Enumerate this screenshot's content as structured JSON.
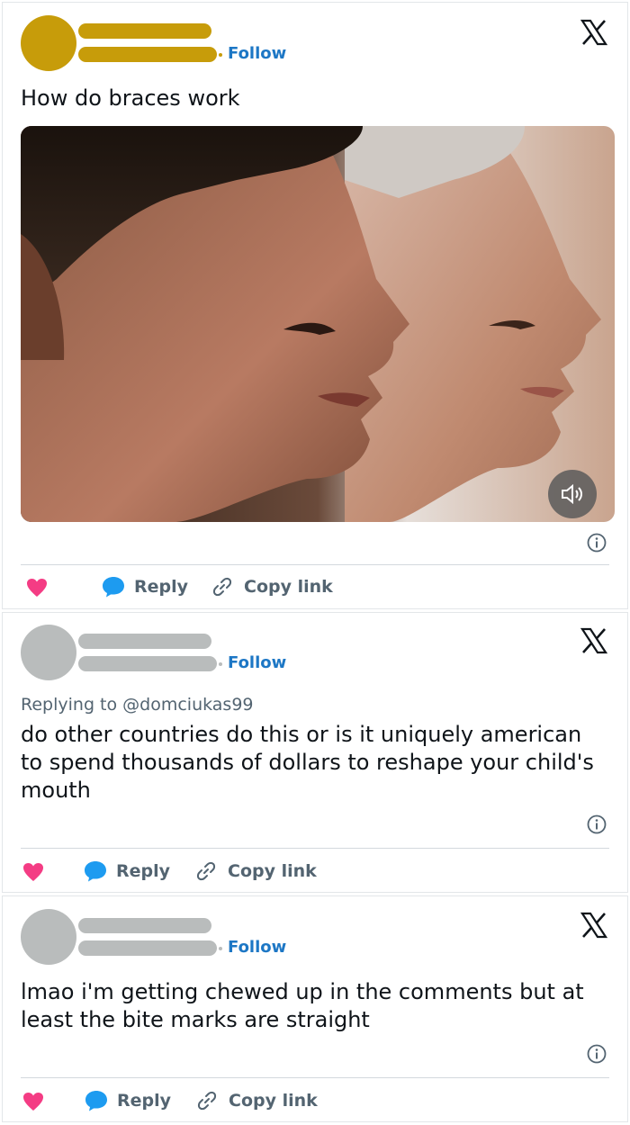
{
  "colors": {
    "avatar_op": "#c79c0a",
    "avatar_reply": "#b9bcbc",
    "follow_blue": "#1d77c5",
    "heart_pink": "#f43c84",
    "bubble_blue": "#1d9bf0",
    "muted_text": "#536471"
  },
  "posts": [
    {
      "follow_label": "Follow",
      "text": "How do braces work",
      "media": {
        "type": "video",
        "sound_icon": "speaker-icon"
      },
      "actions": {
        "reply_label": "Reply",
        "copy_label": "Copy link"
      }
    },
    {
      "follow_label": "Follow",
      "replying_to": "Replying to @domciukas99",
      "text": "do other countries do this or is it uniquely american to spend thousands of dollars to reshape your child's mouth",
      "actions": {
        "reply_label": "Reply",
        "copy_label": "Copy link"
      }
    },
    {
      "follow_label": "Follow",
      "text": "lmao i'm getting chewed up in the comments but at least the bite marks are straight",
      "actions": {
        "reply_label": "Reply",
        "copy_label": "Copy link"
      }
    }
  ]
}
